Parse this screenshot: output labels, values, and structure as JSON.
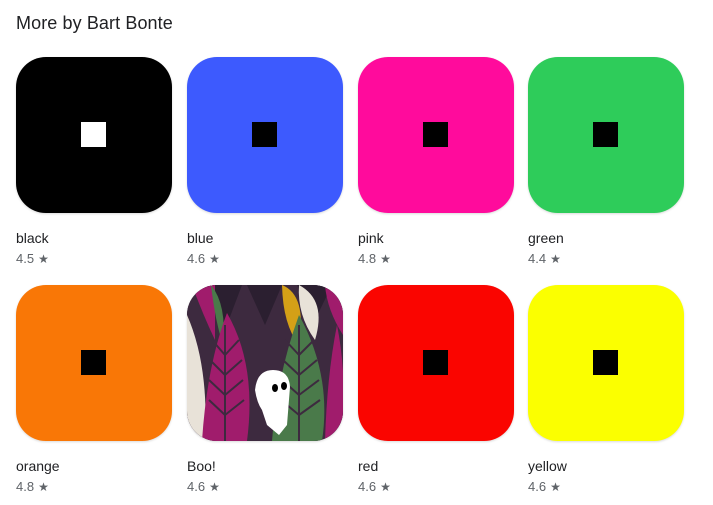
{
  "section": {
    "title": "More by Bart Bonte"
  },
  "apps": [
    {
      "name": "black",
      "rating": "4.5",
      "bg": "#000000",
      "square": "#ffffff"
    },
    {
      "name": "blue",
      "rating": "4.6",
      "bg": "#3d5afe",
      "square": "#000000"
    },
    {
      "name": "pink",
      "rating": "4.8",
      "bg": "#ff0b9c",
      "square": "#000000"
    },
    {
      "name": "green",
      "rating": "4.4",
      "bg": "#2ecc5a",
      "square": "#000000"
    },
    {
      "name": "orange",
      "rating": "4.8",
      "bg": "#f97706",
      "square": "#000000"
    },
    {
      "name": "Boo!",
      "rating": "4.6",
      "bg": "#3d2a3f",
      "square": ""
    },
    {
      "name": "red",
      "rating": "4.6",
      "bg": "#fa0500",
      "square": "#000000"
    },
    {
      "name": "yellow",
      "rating": "4.6",
      "bg": "#fbff00",
      "square": "#000000"
    }
  ],
  "icons": {
    "star": "★"
  }
}
